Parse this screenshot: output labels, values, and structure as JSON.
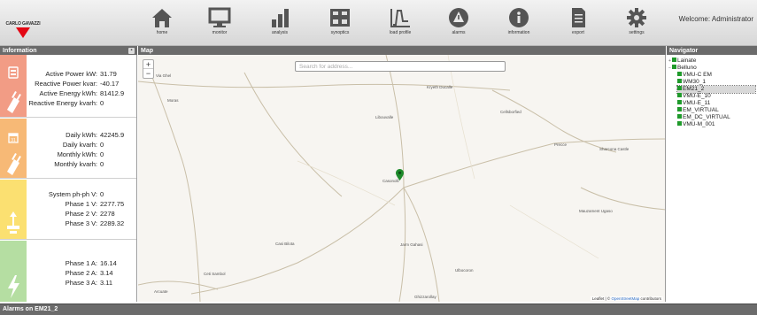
{
  "brand": {
    "name": "CARLO GAVAZZI",
    "accent": "#e30613"
  },
  "nav": [
    {
      "label": "home",
      "icon": "home-icon"
    },
    {
      "label": "monitor",
      "icon": "monitor-icon"
    },
    {
      "label": "analysis",
      "icon": "bar-chart-icon"
    },
    {
      "label": "synoptics",
      "icon": "synoptics-icon"
    },
    {
      "label": "load profile",
      "icon": "load-profile-icon"
    },
    {
      "label": "alarms",
      "icon": "alarm-icon"
    },
    {
      "label": "information",
      "icon": "info-icon"
    },
    {
      "label": "export",
      "icon": "export-icon"
    },
    {
      "label": "settings",
      "icon": "gear-icon"
    }
  ],
  "welcome": "Welcome: Administrator",
  "info_panel": {
    "title": "Information",
    "sections": [
      {
        "color": "#f29c85",
        "rows": [
          {
            "label": "Active Power kW:",
            "value": "31.79"
          },
          {
            "label": "Reactive Power kvar:",
            "value": "-40.17"
          },
          {
            "label": "Active Energy kWh:",
            "value": "81412.9"
          },
          {
            "label": "Reactive Energy kvarh:",
            "value": "0"
          }
        ]
      },
      {
        "color": "#f7b976",
        "rows": [
          {
            "label": "Daily kWh:",
            "value": "42245.9"
          },
          {
            "label": "Daily kvarh:",
            "value": "0"
          },
          {
            "label": "Monthly kWh:",
            "value": "0"
          },
          {
            "label": "Monthly kvarh:",
            "value": "0"
          }
        ]
      },
      {
        "color": "#fbe071",
        "rows": [
          {
            "label": "System ph-ph V:",
            "value": "0"
          },
          {
            "label": "Phase 1 V:",
            "value": "2277.75"
          },
          {
            "label": "Phase 2 V:",
            "value": "2278"
          },
          {
            "label": "Phase 3 V:",
            "value": "2289.32"
          }
        ]
      },
      {
        "color": "#b5dea2",
        "rows": [
          {
            "label": "Phase 1 A:",
            "value": "16.14"
          },
          {
            "label": "Phase 2 A:",
            "value": "3.14"
          },
          {
            "label": "Phase 3 A:",
            "value": "3.11"
          }
        ]
      }
    ]
  },
  "map": {
    "title": "Map",
    "search_placeholder": "Search for address...",
    "zoom_in": "+",
    "zoom_out": "−",
    "attribution_prefix": "Leaflet | © ",
    "attribution_link": "OpenStreetMap",
    "attribution_suffix": " contributors",
    "labels": [
      "Via Ghel",
      "Moras",
      "Kryeth Ducalle",
      "Libouvalle",
      "Cellsborfied",
      "Precce",
      "Sharcona Castle",
      "Casonolli",
      "Mauzament Ugaso",
      "Casi Bilota",
      "Jarm Gahasi",
      "Ceti Sambol",
      "Ulbocoron",
      "Arcuate",
      "Ghizzarollay"
    ]
  },
  "navigator": {
    "title": "Navigator",
    "items": [
      {
        "label": "Lainate",
        "toggle": "+",
        "selected": false
      },
      {
        "label": "Belluno",
        "toggle": "−",
        "selected": false
      },
      {
        "label": "VMU-C EM",
        "toggle": "",
        "selected": false
      },
      {
        "label": "WM30_1",
        "toggle": "",
        "selected": false
      },
      {
        "label": "EM21_2",
        "toggle": "",
        "selected": true
      },
      {
        "label": "VMU-E_10",
        "toggle": "",
        "selected": false
      },
      {
        "label": "VMU-E_11",
        "toggle": "",
        "selected": false
      },
      {
        "label": "EM_VIRTUAL",
        "toggle": "",
        "selected": false
      },
      {
        "label": "EM_DC_VIRTUAL",
        "toggle": "",
        "selected": false
      },
      {
        "label": "VMU-M_001",
        "toggle": "",
        "selected": false
      }
    ]
  },
  "alarms_bar": "Alarms on EM21_2"
}
